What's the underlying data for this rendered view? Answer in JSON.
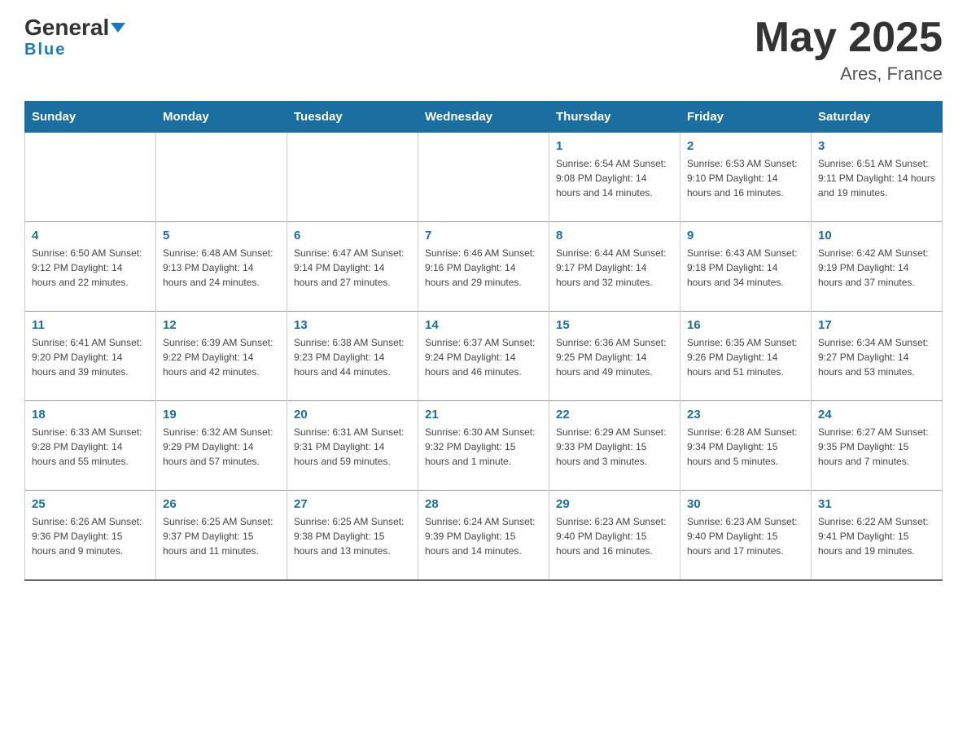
{
  "header": {
    "logo_general": "General",
    "logo_blue": "Blue",
    "month_title": "May 2025",
    "location": "Ares, France"
  },
  "days_of_week": [
    "Sunday",
    "Monday",
    "Tuesday",
    "Wednesday",
    "Thursday",
    "Friday",
    "Saturday"
  ],
  "weeks": [
    [
      {
        "day": "",
        "info": ""
      },
      {
        "day": "",
        "info": ""
      },
      {
        "day": "",
        "info": ""
      },
      {
        "day": "",
        "info": ""
      },
      {
        "day": "1",
        "info": "Sunrise: 6:54 AM\nSunset: 9:08 PM\nDaylight: 14 hours and 14 minutes."
      },
      {
        "day": "2",
        "info": "Sunrise: 6:53 AM\nSunset: 9:10 PM\nDaylight: 14 hours and 16 minutes."
      },
      {
        "day": "3",
        "info": "Sunrise: 6:51 AM\nSunset: 9:11 PM\nDaylight: 14 hours and 19 minutes."
      }
    ],
    [
      {
        "day": "4",
        "info": "Sunrise: 6:50 AM\nSunset: 9:12 PM\nDaylight: 14 hours and 22 minutes."
      },
      {
        "day": "5",
        "info": "Sunrise: 6:48 AM\nSunset: 9:13 PM\nDaylight: 14 hours and 24 minutes."
      },
      {
        "day": "6",
        "info": "Sunrise: 6:47 AM\nSunset: 9:14 PM\nDaylight: 14 hours and 27 minutes."
      },
      {
        "day": "7",
        "info": "Sunrise: 6:46 AM\nSunset: 9:16 PM\nDaylight: 14 hours and 29 minutes."
      },
      {
        "day": "8",
        "info": "Sunrise: 6:44 AM\nSunset: 9:17 PM\nDaylight: 14 hours and 32 minutes."
      },
      {
        "day": "9",
        "info": "Sunrise: 6:43 AM\nSunset: 9:18 PM\nDaylight: 14 hours and 34 minutes."
      },
      {
        "day": "10",
        "info": "Sunrise: 6:42 AM\nSunset: 9:19 PM\nDaylight: 14 hours and 37 minutes."
      }
    ],
    [
      {
        "day": "11",
        "info": "Sunrise: 6:41 AM\nSunset: 9:20 PM\nDaylight: 14 hours and 39 minutes."
      },
      {
        "day": "12",
        "info": "Sunrise: 6:39 AM\nSunset: 9:22 PM\nDaylight: 14 hours and 42 minutes."
      },
      {
        "day": "13",
        "info": "Sunrise: 6:38 AM\nSunset: 9:23 PM\nDaylight: 14 hours and 44 minutes."
      },
      {
        "day": "14",
        "info": "Sunrise: 6:37 AM\nSunset: 9:24 PM\nDaylight: 14 hours and 46 minutes."
      },
      {
        "day": "15",
        "info": "Sunrise: 6:36 AM\nSunset: 9:25 PM\nDaylight: 14 hours and 49 minutes."
      },
      {
        "day": "16",
        "info": "Sunrise: 6:35 AM\nSunset: 9:26 PM\nDaylight: 14 hours and 51 minutes."
      },
      {
        "day": "17",
        "info": "Sunrise: 6:34 AM\nSunset: 9:27 PM\nDaylight: 14 hours and 53 minutes."
      }
    ],
    [
      {
        "day": "18",
        "info": "Sunrise: 6:33 AM\nSunset: 9:28 PM\nDaylight: 14 hours and 55 minutes."
      },
      {
        "day": "19",
        "info": "Sunrise: 6:32 AM\nSunset: 9:29 PM\nDaylight: 14 hours and 57 minutes."
      },
      {
        "day": "20",
        "info": "Sunrise: 6:31 AM\nSunset: 9:31 PM\nDaylight: 14 hours and 59 minutes."
      },
      {
        "day": "21",
        "info": "Sunrise: 6:30 AM\nSunset: 9:32 PM\nDaylight: 15 hours and 1 minute."
      },
      {
        "day": "22",
        "info": "Sunrise: 6:29 AM\nSunset: 9:33 PM\nDaylight: 15 hours and 3 minutes."
      },
      {
        "day": "23",
        "info": "Sunrise: 6:28 AM\nSunset: 9:34 PM\nDaylight: 15 hours and 5 minutes."
      },
      {
        "day": "24",
        "info": "Sunrise: 6:27 AM\nSunset: 9:35 PM\nDaylight: 15 hours and 7 minutes."
      }
    ],
    [
      {
        "day": "25",
        "info": "Sunrise: 6:26 AM\nSunset: 9:36 PM\nDaylight: 15 hours and 9 minutes."
      },
      {
        "day": "26",
        "info": "Sunrise: 6:25 AM\nSunset: 9:37 PM\nDaylight: 15 hours and 11 minutes."
      },
      {
        "day": "27",
        "info": "Sunrise: 6:25 AM\nSunset: 9:38 PM\nDaylight: 15 hours and 13 minutes."
      },
      {
        "day": "28",
        "info": "Sunrise: 6:24 AM\nSunset: 9:39 PM\nDaylight: 15 hours and 14 minutes."
      },
      {
        "day": "29",
        "info": "Sunrise: 6:23 AM\nSunset: 9:40 PM\nDaylight: 15 hours and 16 minutes."
      },
      {
        "day": "30",
        "info": "Sunrise: 6:23 AM\nSunset: 9:40 PM\nDaylight: 15 hours and 17 minutes."
      },
      {
        "day": "31",
        "info": "Sunrise: 6:22 AM\nSunset: 9:41 PM\nDaylight: 15 hours and 19 minutes."
      }
    ]
  ]
}
